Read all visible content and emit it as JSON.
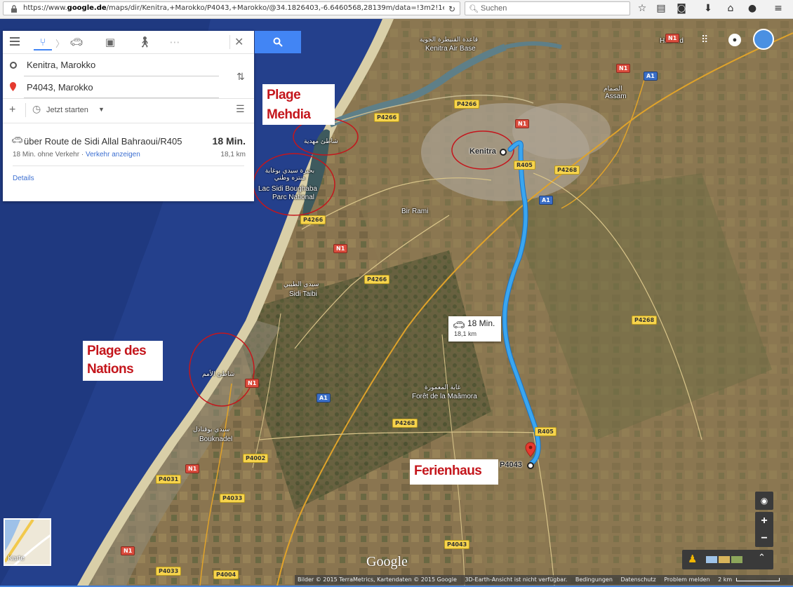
{
  "browser": {
    "url_prefix": "https://www.",
    "url_domain": "google.de",
    "url_rest": "/maps/dir/Kenitra,+Marokko/P4043,+Marokko/@34.1826403,-6.6460568,28139m/data=!3m2!1e3!4b1!4m13!4r",
    "search_placeholder": "Suchen"
  },
  "directions": {
    "origin": "Kenitra, Marokko",
    "destination": "P4043, Marokko",
    "depart_label": "Jetzt starten",
    "route_name": "über Route de Sidi Allal Bahraoui/R405",
    "route_time": "18 Min.",
    "route_note": "18 Min. ohne Verkehr · ",
    "traffic_link": "Verkehr anzeigen",
    "route_distance": "18,1 km",
    "details_link": "Details"
  },
  "map": {
    "route_info": {
      "time": "18 Min.",
      "distance": "18,1 km"
    },
    "places": {
      "kenitra": "Kenitra",
      "bir_rami": "Bir Rami",
      "sidi_taibi": "Sidi Taibi",
      "sidi_taibi_ar": "سيدي الطيبي",
      "foret": "Forêt de la Maâmora",
      "foret_ar": "غابة المعمورة",
      "bouknadel": "Bouknadel",
      "bouknadel_ar": "سيدي بوقنادل",
      "lac_1": "Lac Sidi Boughaba",
      "lac_2": "Parc National",
      "lac_ar": "بحيرة سيدي بوغابة منتزه وطني",
      "mehdia_ar": "شاطئ مهدية",
      "nations_ar": "شاطئ الأمم",
      "air_base": "Kenitra Air Base",
      "air_base_ar": "قاعدة القنيطرة الجوية",
      "assam": "Assam",
      "assam_ar": "الصمام",
      "hasmid": "Hasmid",
      "destination": "P4043"
    },
    "shields": {
      "p4266": "P4266",
      "p4268": "P4268",
      "r405": "R405",
      "a1": "A1",
      "n1": "N1",
      "p4002": "P4002",
      "p4033": "P4033",
      "p4031": "P4031",
      "p4043": "P4043",
      "p4004": "P4004"
    },
    "callouts": {
      "mehdia": "Plage Mehdia",
      "nations_1": "Plage des",
      "nations_2": "Nations",
      "ferienhaus": "Ferienhaus"
    },
    "layer_label": "Karte",
    "logo": "Google",
    "footer": {
      "imagery": "Bilder © 2015 TerraMetrics, Kartendaten © 2015 Google",
      "3d": "3D-Earth-Ansicht ist nicht verfügbar.",
      "terms": "Bedingungen",
      "privacy": "Datenschutz",
      "report": "Problem melden",
      "scale": "2 km"
    },
    "colors": {
      "route": "#3aa6f0",
      "callout_text": "#c4161c",
      "accent": "#4285f4"
    }
  }
}
